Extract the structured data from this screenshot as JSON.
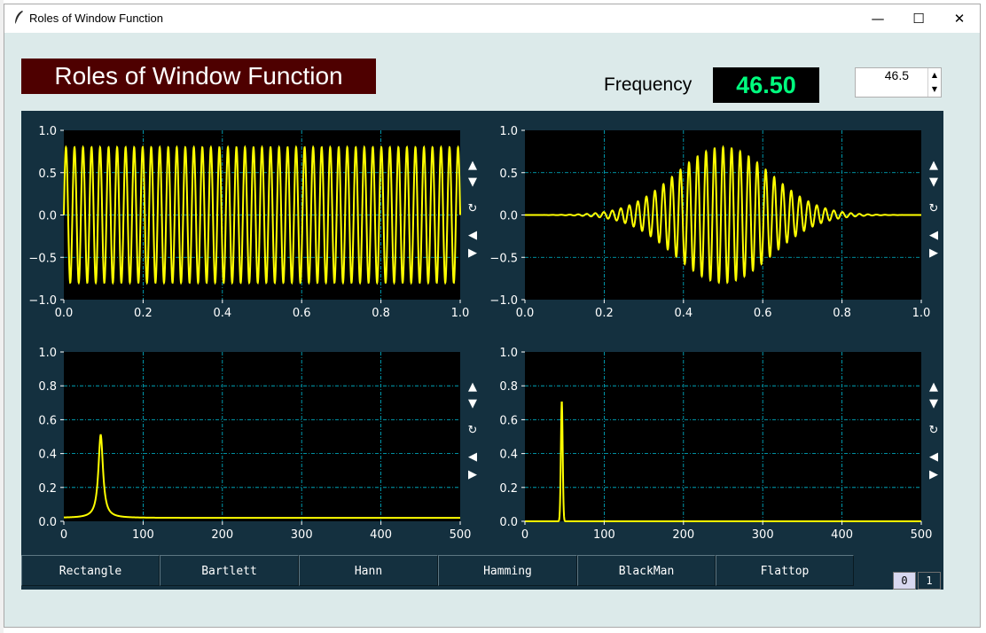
{
  "window": {
    "title": "Roles of Window Function",
    "controls": {
      "minimize": "—",
      "maximize": "☐",
      "close": "✕"
    }
  },
  "header": {
    "title": "Roles of Window Function"
  },
  "frequency": {
    "label": "Frequency",
    "display": "46.50",
    "spin_value": "46.5"
  },
  "plot_controls": [
    "▲",
    "▼",
    "↻",
    "◀",
    "▶"
  ],
  "window_buttons": [
    "Rectangle",
    "Bartlett",
    "Hann",
    "Hamming",
    "BlackMan",
    "Flattop"
  ],
  "pages": [
    "0",
    "1"
  ],
  "colors": {
    "header_bg": "#4e0000",
    "panel_bg": "#14303f",
    "plot_bg": "#000000",
    "line": "#ffff00",
    "grid": "#00bcd4",
    "display_text": "#00ff7f",
    "window_bg": "#dceaea"
  },
  "chart_data": [
    {
      "type": "line",
      "title": "",
      "x_ticks": [
        "0.0",
        "0.2",
        "0.4",
        "0.6",
        "0.8",
        "1.0"
      ],
      "y_ticks": [
        "1.0",
        "0.5",
        "0.0",
        "−0.5",
        "−1.0"
      ],
      "xlim": [
        0,
        1
      ],
      "ylim": [
        -1,
        1
      ],
      "series": [
        {
          "function": "0.8*sin(2*pi*46.5*t)",
          "frequency": 46.5,
          "amplitude": 0.8,
          "window": "Rectangle"
        }
      ],
      "grid": true
    },
    {
      "type": "line",
      "title": "",
      "x_ticks": [
        "0.0",
        "0.2",
        "0.4",
        "0.6",
        "0.8",
        "1.0"
      ],
      "y_ticks": [
        "1.0",
        "0.5",
        "0.0",
        "−0.5",
        "−1.0"
      ],
      "xlim": [
        0,
        1
      ],
      "ylim": [
        -1,
        1
      ],
      "series": [
        {
          "function": "0.8*sin(2*pi*46.5*t)*window(t)",
          "frequency": 46.5,
          "amplitude": 0.8,
          "window": "Gaussian-like taper"
        }
      ],
      "grid": true
    },
    {
      "type": "line",
      "title": "",
      "x_ticks": [
        "0",
        "100",
        "200",
        "300",
        "400",
        "500"
      ],
      "y_ticks": [
        "1.0",
        "0.8",
        "0.6",
        "0.4",
        "0.2",
        "0.0"
      ],
      "xlim": [
        0,
        500
      ],
      "ylim": [
        0,
        1
      ],
      "series": [
        {
          "peak_x": 46.5,
          "peak_y": 0.51,
          "baseline": 0.02,
          "shape": "broad"
        }
      ],
      "grid": true
    },
    {
      "type": "line",
      "title": "",
      "x_ticks": [
        "0",
        "100",
        "200",
        "300",
        "400",
        "500"
      ],
      "y_ticks": [
        "1.0",
        "0.8",
        "0.6",
        "0.4",
        "0.2",
        "0.0"
      ],
      "xlim": [
        0,
        500
      ],
      "ylim": [
        0,
        1
      ],
      "series": [
        {
          "peak_x": 46.5,
          "peak_y": 0.71,
          "baseline": 0.0,
          "shape": "narrow"
        }
      ],
      "grid": true
    }
  ]
}
